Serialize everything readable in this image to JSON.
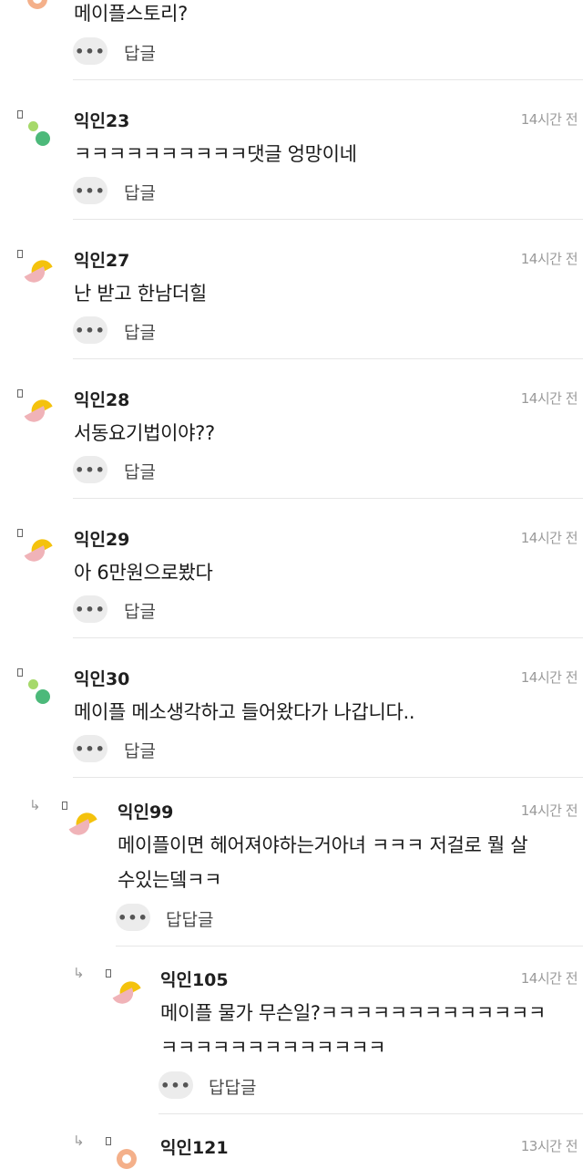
{
  "colors": {
    "avatar_green_light": "#a6d96a",
    "avatar_green": "#4cb97a",
    "avatar_yellow": "#f4c20d",
    "avatar_pink": "#f0b3b8",
    "avatar_peach": "#f4b08a"
  },
  "top_partial": {
    "body": "메이플스토리?",
    "reply": "답글",
    "more": "•••"
  },
  "comments": [
    {
      "name": "익인23",
      "time": "14시간 전",
      "body": "ㅋㅋㅋㅋㅋㅋㅋㅋㅋㅋ댓글 엉망이네",
      "reply": "답글",
      "more": "•••",
      "avatar": "green-dots"
    },
    {
      "name": "익인27",
      "time": "14시간 전",
      "body": "난 받고 한남더힐",
      "reply": "답글",
      "more": "•••",
      "avatar": "yellow-pink"
    },
    {
      "name": "익인28",
      "time": "14시간 전",
      "body": "서동요기법이야??",
      "reply": "답글",
      "more": "•••",
      "avatar": "yellow-pink"
    },
    {
      "name": "익인29",
      "time": "14시간 전",
      "body": "아 6만원으로봤다",
      "reply": "답글",
      "more": "•••",
      "avatar": "yellow-pink"
    },
    {
      "name": "익인30",
      "time": "14시간 전",
      "body": "메이플 메소생각하고 들어왔다가 나갑니다..",
      "reply": "답글",
      "more": "•••",
      "avatar": "green-dots"
    }
  ],
  "replies": [
    {
      "name": "익인99",
      "time": "14시간 전",
      "body_line1": "메이플이면 헤어져야하는거아녀 ㅋㅋㅋ 저걸로 뭘 살",
      "body_line2": "수있는뎈ㅋㅋ",
      "reply": "답답글",
      "more": "•••",
      "avatar": "yellow-pink"
    },
    {
      "name": "익인105",
      "time": "14시간 전",
      "body_line1": "메이플 물가 무슨일?ㅋㅋㅋㅋㅋㅋㅋㅋㅋㅋㅋㅋㅋ",
      "body_line2": "ㅋㅋㅋㅋㅋㅋㅋㅋㅋㅋㅋㅋㅋ",
      "reply": "답답글",
      "more": "•••",
      "avatar": "yellow-pink"
    },
    {
      "name": "익인121",
      "time": "13시간 전",
      "avatar": "peach-ring"
    }
  ],
  "reply_arrow": "↳"
}
